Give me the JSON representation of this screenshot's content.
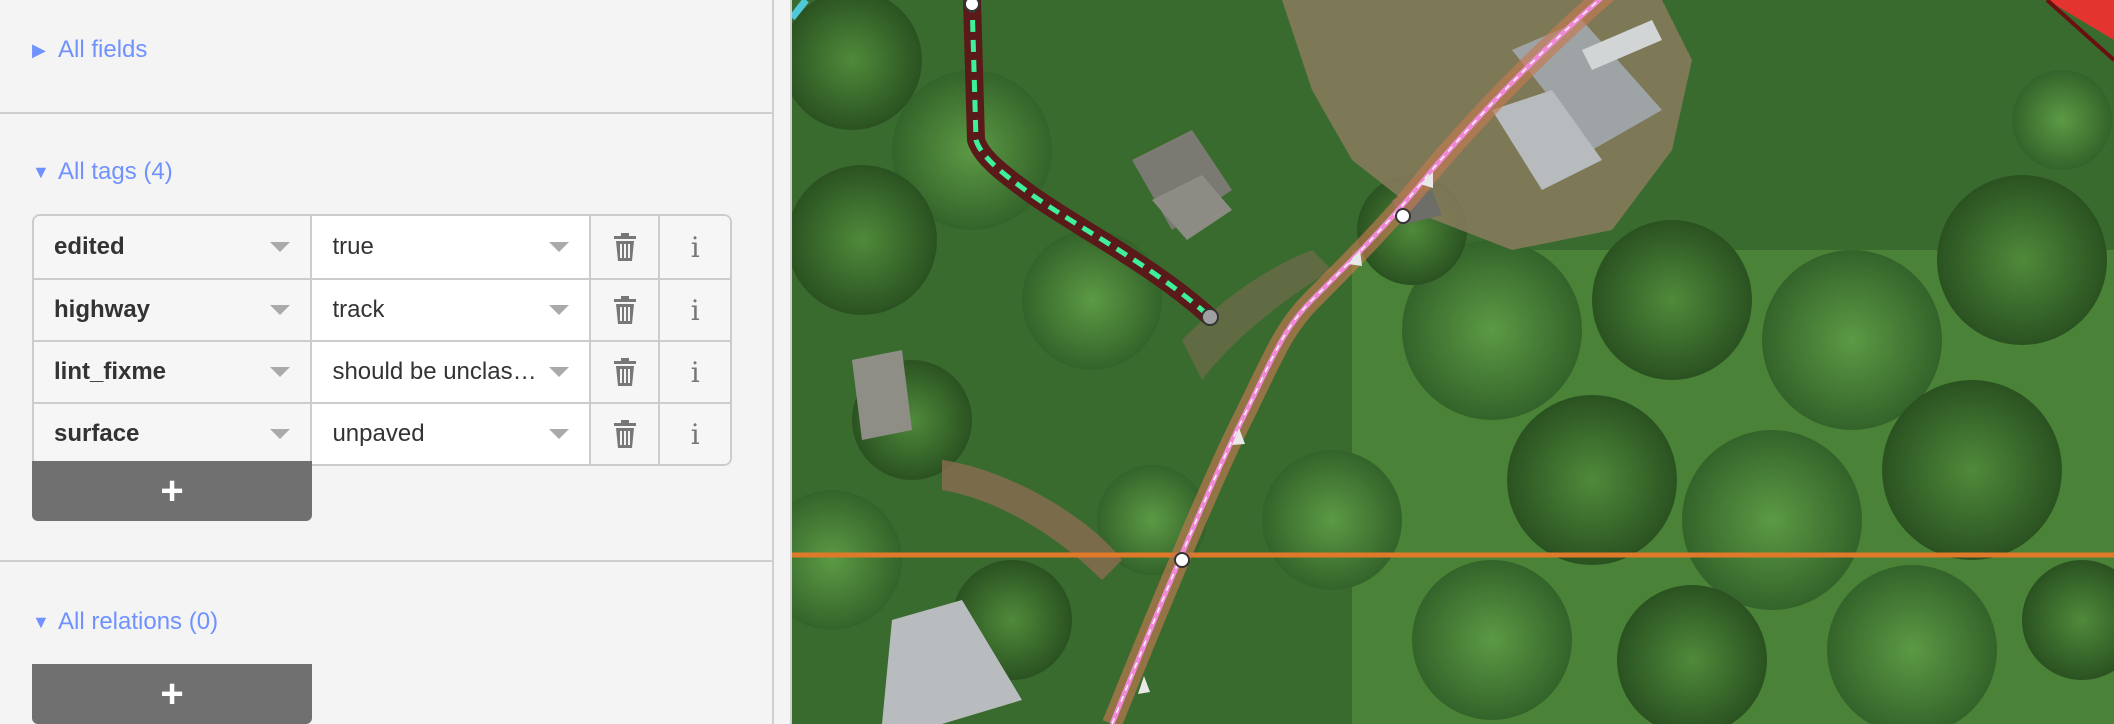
{
  "sidebar": {
    "all_fields": {
      "label": "All fields",
      "expanded": false
    },
    "all_tags": {
      "label": "All tags (4)",
      "expanded": true,
      "rows": [
        {
          "key": "edited",
          "value": "true"
        },
        {
          "key": "highway",
          "value": "track"
        },
        {
          "key": "lint_fixme",
          "value": "should be unclas…"
        },
        {
          "key": "surface",
          "value": "unpaved"
        }
      ],
      "add_label": "+"
    },
    "all_relations": {
      "label": "All relations (0)",
      "expanded": true,
      "add_label": "+"
    }
  },
  "icons": {
    "collapsed": "▶",
    "expanded": "▼",
    "delete": "trash-icon",
    "info": "info-icon",
    "info_glyph": "i"
  },
  "colors": {
    "accent": "#7092ff",
    "button_bg": "#707070",
    "selected_way": "#5a1a1a",
    "selected_way_dash": "#3ff09a",
    "track_way": "#f08ad8",
    "track_casing": "#c47a50",
    "boundary_line": "#e07a2a"
  }
}
